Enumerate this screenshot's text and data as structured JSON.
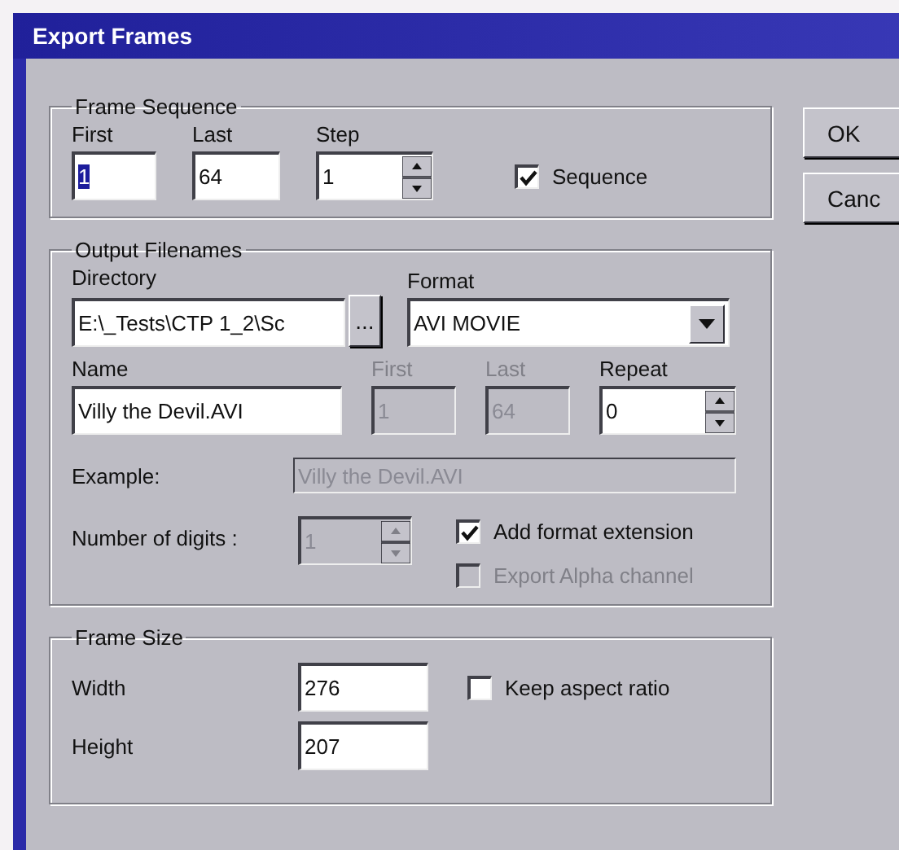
{
  "window": {
    "title": "Export Frames"
  },
  "frame_sequence": {
    "title": "Frame Sequence",
    "first": {
      "label": "First",
      "value": "1",
      "text_selected": true
    },
    "last": {
      "label": "Last",
      "value": "64"
    },
    "step": {
      "label": "Step",
      "value": "1"
    },
    "sequence": {
      "label": "Sequence",
      "checked": true
    }
  },
  "output_filenames": {
    "title": "Output Filenames",
    "directory": {
      "label": "Directory",
      "value": "E:\\_Tests\\CTP 1_2\\Sc"
    },
    "browse": "...",
    "format": {
      "label": "Format",
      "value": "AVI MOVIE"
    },
    "name": {
      "label": "Name",
      "value": "Villy the Devil.AVI"
    },
    "first": {
      "label": "First",
      "value": "1",
      "disabled": true
    },
    "last": {
      "label": "Last",
      "value": "64",
      "disabled": true
    },
    "repeat": {
      "label": "Repeat",
      "value": "0"
    },
    "example": {
      "label": "Example:",
      "value": "Villy the Devil.AVI"
    },
    "digits": {
      "label": "Number of digits :",
      "value": "1",
      "disabled": true
    },
    "checkboxes": [
      {
        "label": "Add format extension",
        "checked": true,
        "disabled": false
      },
      {
        "label": "Export Alpha channel",
        "checked": false,
        "disabled": true
      }
    ]
  },
  "frame_size": {
    "title": "Frame Size",
    "width": {
      "label": "Width",
      "value": "276"
    },
    "height": {
      "label": "Height",
      "value": "207"
    },
    "keep_aspect": {
      "label": "Keep aspect ratio",
      "checked": false
    }
  },
  "buttons": [
    "OK",
    "Canc"
  ]
}
